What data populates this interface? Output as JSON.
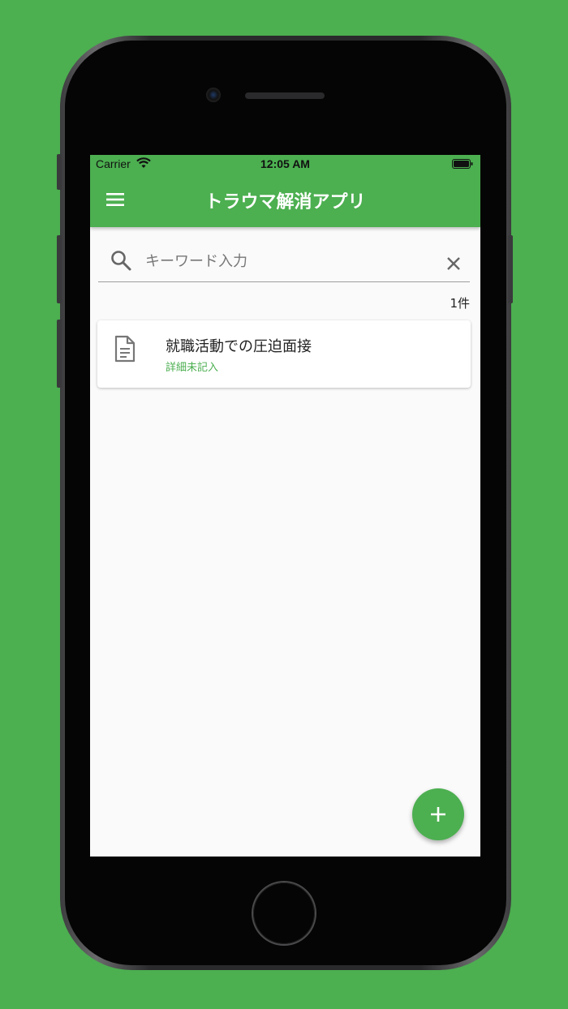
{
  "status_bar": {
    "carrier": "Carrier",
    "time": "12:05 AM"
  },
  "app_bar": {
    "title": "トラウマ解消アプリ",
    "menu_icon": "hamburger-menu-icon"
  },
  "search": {
    "placeholder": "キーワード入力",
    "value": "",
    "icon": "search-icon",
    "clear_icon": "close-icon"
  },
  "result_count": "1件",
  "items": [
    {
      "title": "就職活動での圧迫面接",
      "subtitle": "詳細未記入",
      "icon": "document-icon"
    }
  ],
  "fab": {
    "icon": "plus-icon"
  },
  "colors": {
    "primary": "#4caf50",
    "background": "#fafafa",
    "card": "#ffffff"
  }
}
